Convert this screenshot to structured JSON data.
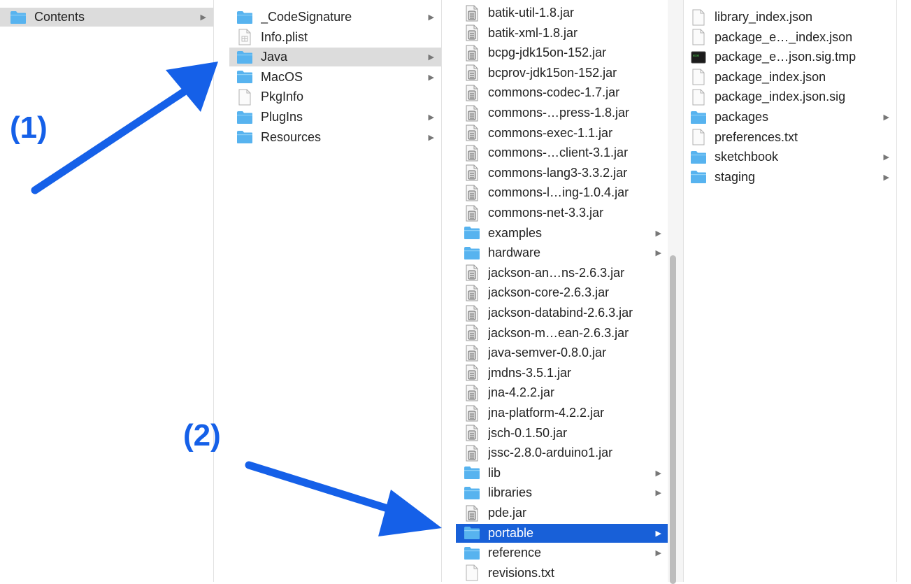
{
  "colors": {
    "folder": "#57b3ef",
    "selection": "#1860d8",
    "arrow": "#1560e8",
    "highlight": "#dcdcdc"
  },
  "annotations": {
    "label1": "(1)",
    "label2": "(2)"
  },
  "col1": {
    "items": [
      {
        "label": "Contents",
        "icon": "folder-icon",
        "folder": true,
        "state": "highlight"
      }
    ]
  },
  "col2": {
    "items": [
      {
        "label": "_CodeSignature",
        "icon": "folder-icon",
        "folder": true
      },
      {
        "label": "Info.plist",
        "icon": "plist-file-icon",
        "folder": false
      },
      {
        "label": "Java",
        "icon": "folder-icon",
        "folder": true,
        "state": "highlight"
      },
      {
        "label": "MacOS",
        "icon": "folder-icon",
        "folder": true
      },
      {
        "label": "PkgInfo",
        "icon": "document-icon",
        "folder": false
      },
      {
        "label": "PlugIns",
        "icon": "folder-icon",
        "folder": true
      },
      {
        "label": "Resources",
        "icon": "folder-icon",
        "folder": true
      }
    ]
  },
  "col3": {
    "items": [
      {
        "label": "batik-util-1.8.jar",
        "icon": "jar-file-icon",
        "folder": false
      },
      {
        "label": "batik-xml-1.8.jar",
        "icon": "jar-file-icon",
        "folder": false
      },
      {
        "label": "bcpg-jdk15on-152.jar",
        "icon": "jar-file-icon",
        "folder": false
      },
      {
        "label": "bcprov-jdk15on-152.jar",
        "icon": "jar-file-icon",
        "folder": false
      },
      {
        "label": "commons-codec-1.7.jar",
        "icon": "jar-file-icon",
        "folder": false
      },
      {
        "label": "commons-…press-1.8.jar",
        "icon": "jar-file-icon",
        "folder": false
      },
      {
        "label": "commons-exec-1.1.jar",
        "icon": "jar-file-icon",
        "folder": false
      },
      {
        "label": "commons-…client-3.1.jar",
        "icon": "jar-file-icon",
        "folder": false
      },
      {
        "label": "commons-lang3-3.3.2.jar",
        "icon": "jar-file-icon",
        "folder": false
      },
      {
        "label": "commons-l…ing-1.0.4.jar",
        "icon": "jar-file-icon",
        "folder": false
      },
      {
        "label": "commons-net-3.3.jar",
        "icon": "jar-file-icon",
        "folder": false
      },
      {
        "label": "examples",
        "icon": "folder-icon",
        "folder": true
      },
      {
        "label": "hardware",
        "icon": "folder-icon",
        "folder": true
      },
      {
        "label": "jackson-an…ns-2.6.3.jar",
        "icon": "jar-file-icon",
        "folder": false
      },
      {
        "label": "jackson-core-2.6.3.jar",
        "icon": "jar-file-icon",
        "folder": false
      },
      {
        "label": "jackson-databind-2.6.3.jar",
        "icon": "jar-file-icon",
        "folder": false
      },
      {
        "label": "jackson-m…ean-2.6.3.jar",
        "icon": "jar-file-icon",
        "folder": false
      },
      {
        "label": "java-semver-0.8.0.jar",
        "icon": "jar-file-icon",
        "folder": false
      },
      {
        "label": "jmdns-3.5.1.jar",
        "icon": "jar-file-icon",
        "folder": false
      },
      {
        "label": "jna-4.2.2.jar",
        "icon": "jar-file-icon",
        "folder": false
      },
      {
        "label": "jna-platform-4.2.2.jar",
        "icon": "jar-file-icon",
        "folder": false
      },
      {
        "label": "jsch-0.1.50.jar",
        "icon": "jar-file-icon",
        "folder": false
      },
      {
        "label": "jssc-2.8.0-arduino1.jar",
        "icon": "jar-file-icon",
        "folder": false
      },
      {
        "label": "lib",
        "icon": "folder-icon",
        "folder": true
      },
      {
        "label": "libraries",
        "icon": "folder-icon",
        "folder": true
      },
      {
        "label": "pde.jar",
        "icon": "jar-file-icon",
        "folder": false
      },
      {
        "label": "portable",
        "icon": "folder-icon",
        "folder": true,
        "state": "selected"
      },
      {
        "label": "reference",
        "icon": "folder-icon",
        "folder": true
      },
      {
        "label": "revisions.txt",
        "icon": "document-icon",
        "folder": false
      }
    ]
  },
  "col4": {
    "items": [
      {
        "label": "library_index.json",
        "icon": "document-icon",
        "folder": false
      },
      {
        "label": "package_e…_index.json",
        "icon": "document-icon",
        "folder": false
      },
      {
        "label": "package_e…json.sig.tmp",
        "icon": "exec-file-icon",
        "folder": false
      },
      {
        "label": "package_index.json",
        "icon": "document-icon",
        "folder": false
      },
      {
        "label": "package_index.json.sig",
        "icon": "document-icon",
        "folder": false
      },
      {
        "label": "packages",
        "icon": "folder-icon",
        "folder": true
      },
      {
        "label": "preferences.txt",
        "icon": "document-icon",
        "folder": false
      },
      {
        "label": "sketchbook",
        "icon": "folder-icon",
        "folder": true
      },
      {
        "label": "staging",
        "icon": "folder-icon",
        "folder": true
      }
    ]
  }
}
